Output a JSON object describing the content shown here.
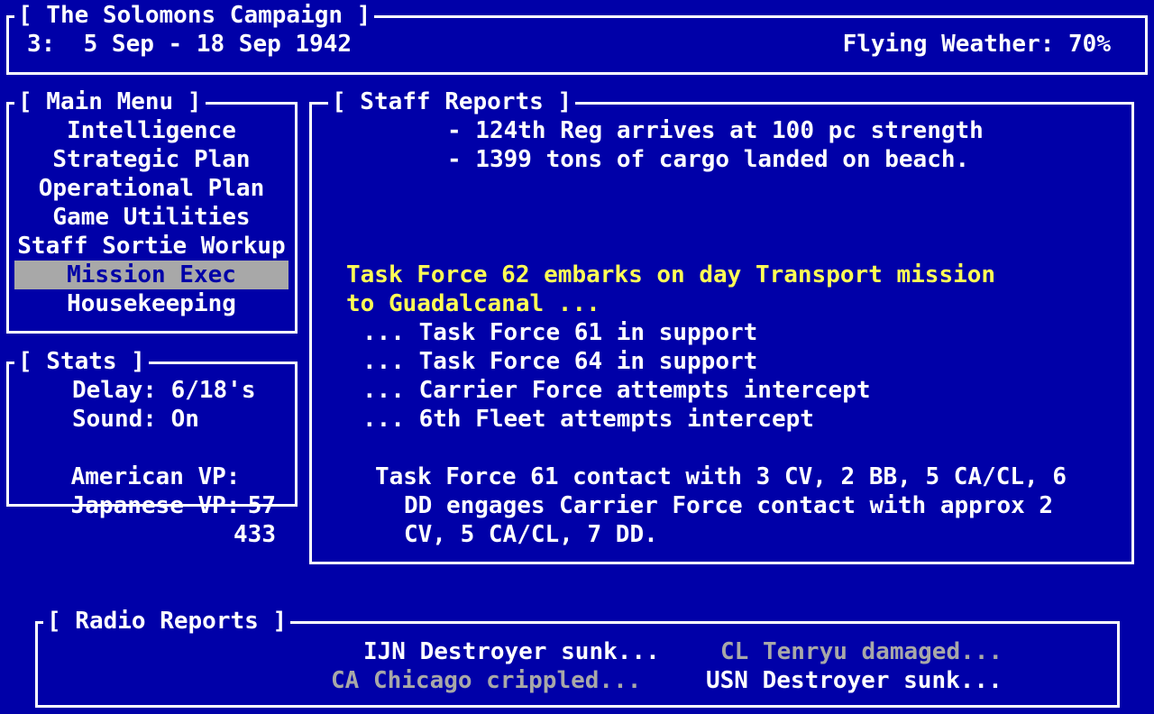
{
  "campaign": {
    "title": "[ The Solomons Campaign ]",
    "turn": "3:  5 Sep - 18 Sep 1942",
    "weather": "Flying Weather: 70%"
  },
  "main_menu": {
    "title": "[ Main Menu ]",
    "items": [
      {
        "label": "Intelligence"
      },
      {
        "label": "Strategic Plan"
      },
      {
        "label": "Operational Plan"
      },
      {
        "label": "Game Utilities"
      },
      {
        "label": "Staff Sortie Workup"
      },
      {
        "label": "Mission Exec",
        "selected": true
      },
      {
        "label": "Housekeeping"
      }
    ]
  },
  "stats": {
    "title": "[ Stats ]",
    "delay": "Delay: 6/18's",
    "sound": "Sound: On",
    "american_vp_label": "American VP:",
    "american_vp": "57",
    "japanese_vp_label": "Japanese VP:",
    "japanese_vp": "433"
  },
  "staff_reports": {
    "title": "[ Staff Reports ]",
    "lines": [
      "- 124th Reg arrives at 100 pc strength",
      "- 1399 tons of cargo landed on beach.",
      "Task Force 62 embarks on day Transport mission",
      "to Guadalcanal ...",
      "... Task Force 61 in support",
      "... Task Force 64 in support",
      "... Carrier Force attempts intercept",
      "... 6th Fleet attempts intercept",
      "Task Force 61 contact with 3 CV, 2 BB, 5 CA/CL, 6",
      "DD engages Carrier Force contact with approx 2",
      "CV, 5 CA/CL, 7 DD."
    ]
  },
  "radio_reports": {
    "title": "[ Radio Reports ]",
    "items": [
      {
        "text": "IJN Destroyer sunk...",
        "tone": "white"
      },
      {
        "text": "CL Tenryu damaged...",
        "tone": "grey"
      },
      {
        "text": "CA Chicago crippled...",
        "tone": "grey"
      },
      {
        "text": "USN Destroyer sunk...",
        "tone": "white"
      }
    ]
  },
  "colors": {
    "background": "#0000a8",
    "text": "#ffffff",
    "highlight": "#ffff55",
    "dim": "#a8a8a8"
  }
}
